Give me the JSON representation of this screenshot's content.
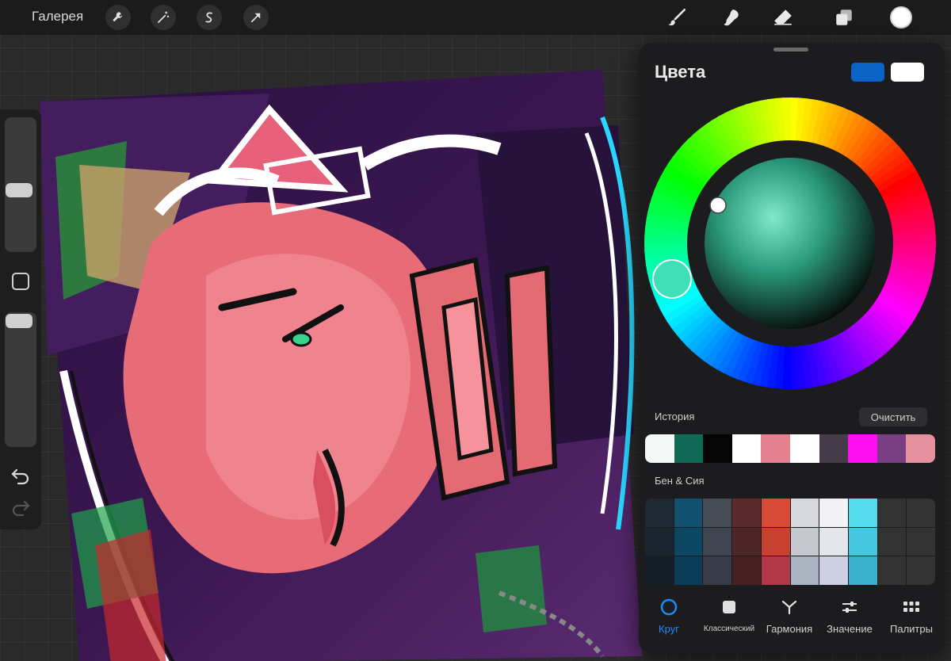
{
  "toolbar": {
    "gallery_label": "Галерея",
    "left_tools": [
      "wrench-icon",
      "magic-wand-icon",
      "selection-icon",
      "transform-arrow-icon"
    ],
    "right_tools": [
      "brush-icon",
      "smudge-icon",
      "eraser-icon",
      "layers-icon"
    ],
    "current_color": "#ffffff"
  },
  "panel": {
    "title": "Цвета",
    "primary_color": "#0b63c5",
    "secondary_color": "#ffffff",
    "history_label": "История",
    "clear_label": "Очистить",
    "history_colors": [
      "#f5f7f6",
      "#0e6a55",
      "#050505",
      "#ffffff",
      "#e4808f",
      "#ffffff",
      "#463c49",
      "#ff10f2",
      "#7a3f83",
      "#e5909d"
    ],
    "palette_name": "Бен & Сия",
    "palette_colors": [
      "#1d2a33",
      "#11506e",
      "#464c56",
      "#5b2b2c",
      "#d84a35",
      "#d7d8dd",
      "#f2f2f4",
      "#56dcef",
      "#333333",
      "#333333",
      "#1a2530",
      "#0c4766",
      "#3e4450",
      "#4f2627",
      "#c8412f",
      "#c6c8d0",
      "#e5e6ec",
      "#46c7e0",
      "#333333",
      "#333333",
      "#161f28",
      "#093d59",
      "#373c48",
      "#462122",
      "#b23848",
      "#aab3c3",
      "#ccd0e2",
      "#3ab0cc",
      "#333333",
      "#333333"
    ],
    "tabs": [
      {
        "label": "Круг",
        "icon": "circle-icon",
        "active": true
      },
      {
        "label": "Классический",
        "icon": "square-icon",
        "active": false
      },
      {
        "label": "Гармония",
        "icon": "harmony-icon",
        "active": false
      },
      {
        "label": "Значение",
        "icon": "sliders-icon",
        "active": false
      },
      {
        "label": "Палитры",
        "icon": "grid-icon",
        "active": false
      }
    ]
  }
}
